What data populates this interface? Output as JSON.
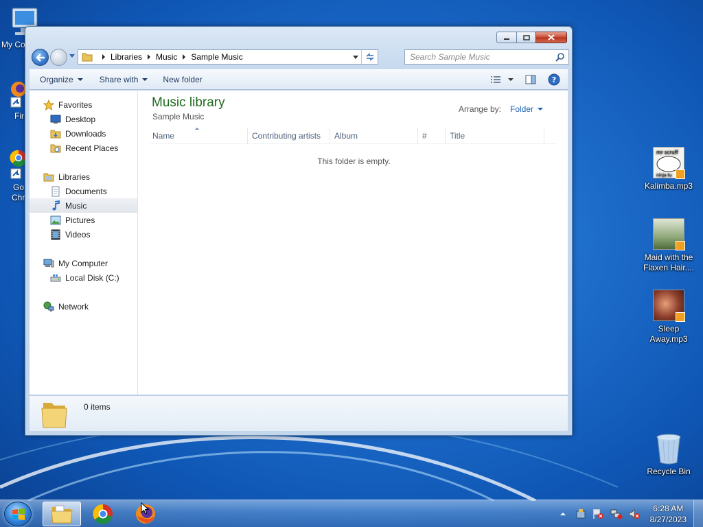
{
  "desktop": {
    "left_icons": [
      {
        "label": "My Co"
      },
      {
        "label": "Fir"
      },
      {
        "label": "Go"
      },
      {
        "label": "Chr"
      }
    ],
    "right_icons": [
      {
        "label_line1": "Kalimba.mp3",
        "label_line2": ""
      },
      {
        "label_line1": "Maid with the",
        "label_line2": "Flaxen Hair...."
      },
      {
        "label_line1": "Sleep",
        "label_line2": "Away.mp3"
      },
      {
        "label_line1": "Recycle Bin",
        "label_line2": ""
      }
    ]
  },
  "explorer": {
    "breadcrumb": [
      "Libraries",
      "Music",
      "Sample Music"
    ],
    "search_placeholder": "Search Sample Music",
    "toolbar": {
      "organize": "Organize",
      "share_with": "Share with",
      "new_folder": "New folder"
    },
    "nav": {
      "favorites": "Favorites",
      "desktop": "Desktop",
      "downloads": "Downloads",
      "recent_places": "Recent Places",
      "libraries": "Libraries",
      "documents": "Documents",
      "music": "Music",
      "pictures": "Pictures",
      "videos": "Videos",
      "my_computer": "My Computer",
      "local_disk": "Local Disk (C:)",
      "network": "Network"
    },
    "content": {
      "library_title": "Music library",
      "library_subtitle": "Sample Music",
      "arrange_label": "Arrange by:",
      "arrange_value": "Folder",
      "columns": [
        "Name",
        "Contributing artists",
        "Album",
        "#",
        "Title"
      ],
      "empty_message": "This folder is empty."
    },
    "details": {
      "item_count": "0 items"
    }
  },
  "taskbar": {
    "time": "6:28 AM",
    "date": "8/27/2023"
  },
  "colors": {
    "library_title": "#1e6c1e",
    "link_blue": "#1a5fb4",
    "close_button": "#c74a33"
  }
}
